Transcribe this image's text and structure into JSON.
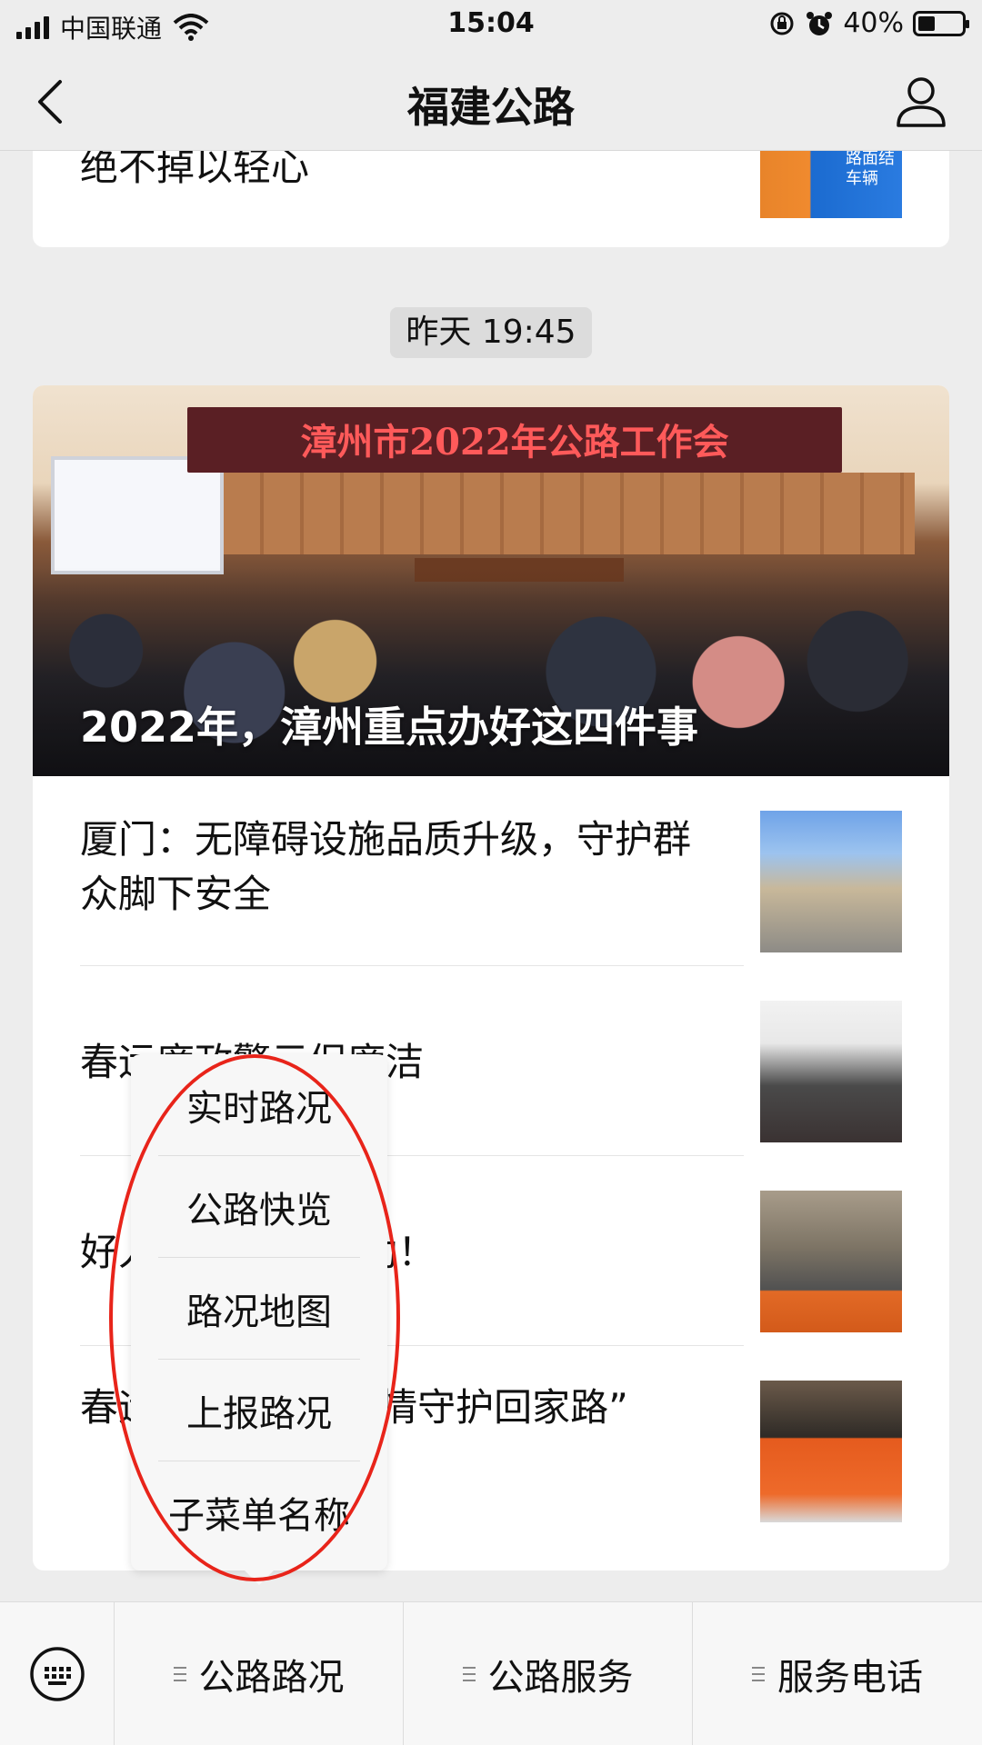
{
  "status_bar": {
    "carrier": "中国联通",
    "time": "15:04",
    "battery": "40%",
    "battery_level": 0.4
  },
  "nav": {
    "title": "福建公路",
    "back_icon": "chevron-left-icon",
    "user_icon": "person-icon"
  },
  "top_card": {
    "title_partial": "绝不掉以轻心",
    "thumb_text": "路面结\n车辆"
  },
  "timestamp": "昨天 19:45",
  "article": {
    "hero_banner": "漳州市2022年公路工作会",
    "hero_title": "2022年，漳州重点办好这四件事",
    "items": [
      {
        "title": "厦门：无障碍设施品质升级，守护群众脚下安全"
      },
      {
        "title": "春运廉政警示促廉洁"
      },
      {
        "title": "好人好事 及时救助！"
      },
      {
        "title": "春运一线 “用心用情守护回家路”"
      }
    ]
  },
  "popup_menu": {
    "items": [
      "实时路况",
      "公路快览",
      "路况地图",
      "上报路况",
      "子菜单名称"
    ]
  },
  "bottom_menu": {
    "keyboard_icon": "keyboard-icon",
    "items": [
      "公路路况",
      "公路服务",
      "服务电话"
    ]
  },
  "colors": {
    "background": "#ededed",
    "annotation_red": "#e8241a"
  }
}
